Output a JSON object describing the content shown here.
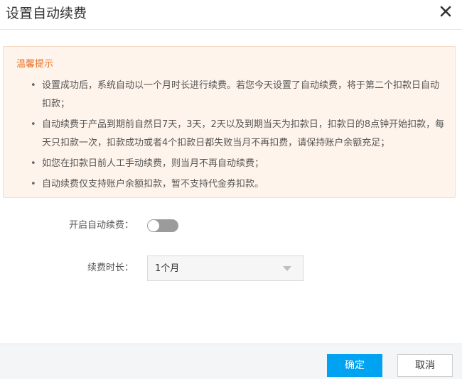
{
  "dialog": {
    "title": "设置自动续费",
    "close_icon": "close-icon"
  },
  "notice": {
    "title": "温馨提示",
    "items": [
      "设置成功后，系统自动以一个月时长进行续费。若您今天设置了自动续费，将于第二个扣款日自动扣款；",
      "自动续费于产品到期前自然日7天，3天，2天以及到期当天为扣款日，扣款日的8点钟开始扣款，每天只扣款一次，扣款成功或者4个扣款日都失败当月不再扣费，请保持账户余额充足；",
      "如您在扣款日前人工手动续费，则当月不再自动续费；",
      "自动续费仅支持账户余额扣款，暂不支持代金券扣款。"
    ],
    "bullet": "•"
  },
  "form": {
    "auto_renew_label": "开启自动续费：",
    "auto_renew_enabled": false,
    "duration_label": "续费时长：",
    "duration_value": "1个月"
  },
  "footer": {
    "confirm_label": "确定",
    "cancel_label": "取消"
  },
  "colors": {
    "primary": "#00a2f2",
    "notice_bg": "#fff4ec",
    "notice_title": "#e67429",
    "toggle_off": "#9b9b9b"
  }
}
